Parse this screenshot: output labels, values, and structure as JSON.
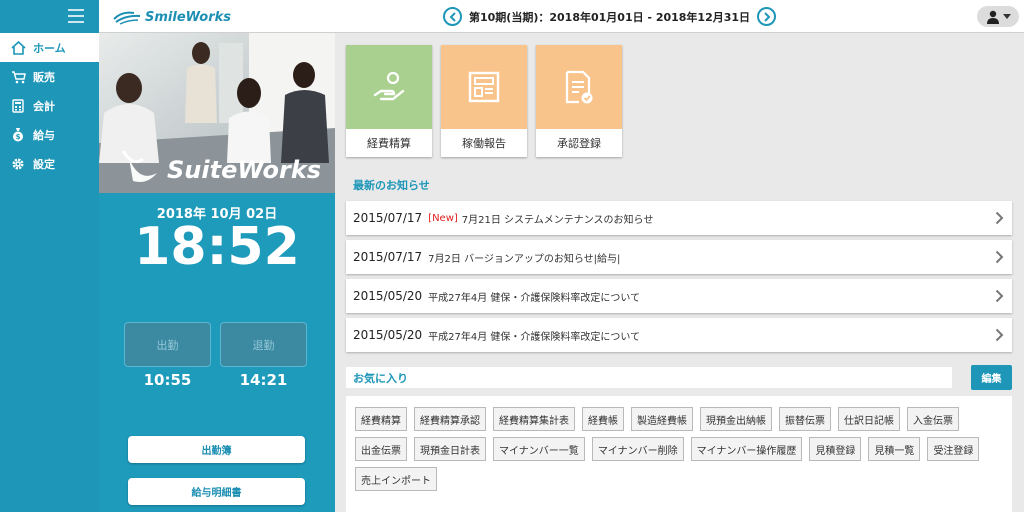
{
  "header": {
    "logo_text": "SmileWorks",
    "period_label": "第10期(当期)：2018年01月01日 - 2018年12月31日"
  },
  "sidebar": {
    "items": [
      {
        "label": "ホーム",
        "icon": "home-icon"
      },
      {
        "label": "販売",
        "icon": "cart-icon"
      },
      {
        "label": "会計",
        "icon": "calculator-icon"
      },
      {
        "label": "給与",
        "icon": "money-bag-icon"
      },
      {
        "label": "設定",
        "icon": "gear-icon"
      }
    ]
  },
  "photo": {
    "brand_text": "SuiteWorks"
  },
  "clock": {
    "date": "2018年 10月 02日",
    "time": "18:52",
    "clock_in_label": "出勤",
    "clock_out_label": "退勤",
    "clock_in_time": "10:55",
    "clock_out_time": "14:21",
    "attendance_button": "出勤簿",
    "payslip_button": "給与明細書"
  },
  "tiles": [
    {
      "label": "経費精算",
      "color": "#a9d08e",
      "icon": "hand-money-icon"
    },
    {
      "label": "稼働報告",
      "color": "#f9c48c",
      "icon": "report-icon"
    },
    {
      "label": "承認登録",
      "color": "#f9c48c",
      "icon": "document-check-icon"
    }
  ],
  "news": {
    "heading": "最新のお知らせ",
    "items": [
      {
        "date": "2015/07/17",
        "badge": "[New]",
        "title": "7月21日 システムメンテナンスのお知らせ"
      },
      {
        "date": "2015/07/17",
        "badge": "",
        "title": "7月2日 バージョンアップのお知らせ|給与|"
      },
      {
        "date": "2015/05/20",
        "badge": "",
        "title": "平成27年4月 健保・介護保険料率改定について"
      },
      {
        "date": "2015/05/20",
        "badge": "",
        "title": "平成27年4月 健保・介護保険料率改定について"
      }
    ]
  },
  "favorites": {
    "heading": "お気に入り",
    "edit_label": "編集",
    "items": [
      "経費精算",
      "経費精算承認",
      "経費精算集計表",
      "経費帳",
      "製造経費帳",
      "現預金出納帳",
      "振替伝票",
      "仕訳日記帳",
      "入金伝票",
      "出金伝票",
      "現預金日計表",
      "マイナンバー一覧",
      "マイナンバー削除",
      "マイナンバー操作履歴",
      "見積登録",
      "見積一覧",
      "受注登録",
      "売上インポート"
    ]
  },
  "colors": {
    "accent": "#1d96b8",
    "new_badge": "#e02020"
  }
}
